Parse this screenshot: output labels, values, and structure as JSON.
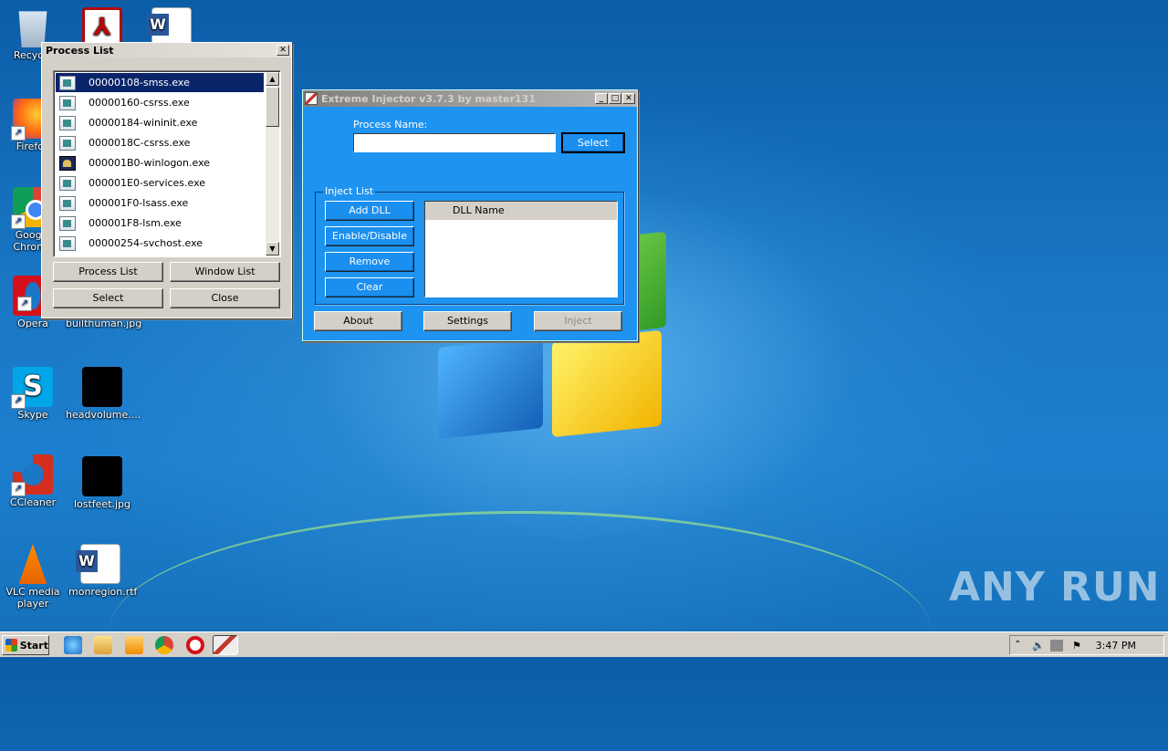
{
  "desktop": {
    "icons": [
      {
        "label": "Recycle",
        "icon": "recycle-bin-icon"
      },
      {
        "label": "",
        "icon": "acrobat-pdf-icon"
      },
      {
        "label": "",
        "icon": "word-document-icon"
      },
      {
        "label": "Firefox",
        "icon": "firefox-icon"
      },
      {
        "label": "Google Chrome",
        "icon": "chrome-icon"
      },
      {
        "label": "Opera",
        "icon": "opera-icon"
      },
      {
        "label": "builthuman.jpg",
        "icon": "image-file-icon"
      },
      {
        "label": "Skype",
        "icon": "skype-icon"
      },
      {
        "label": "headvolume....",
        "icon": "image-file-icon"
      },
      {
        "label": "CCleaner",
        "icon": "ccleaner-icon"
      },
      {
        "label": "lostfeet.jpg",
        "icon": "image-file-icon"
      },
      {
        "label": "VLC media player",
        "icon": "vlc-icon"
      },
      {
        "label": "monregion.rtf",
        "icon": "word-document-icon"
      }
    ]
  },
  "process_list_window": {
    "title": "Process List",
    "close_glyph": "✕",
    "processes": [
      {
        "name": "00000108-smss.exe",
        "selected": true
      },
      {
        "name": "00000160-csrss.exe"
      },
      {
        "name": "00000184-wininit.exe"
      },
      {
        "name": "0000018C-csrss.exe"
      },
      {
        "name": "000001B0-winlogon.exe"
      },
      {
        "name": "000001E0-services.exe"
      },
      {
        "name": "000001F0-lsass.exe"
      },
      {
        "name": "000001F8-lsm.exe"
      },
      {
        "name": "00000254-svchost.exe"
      }
    ],
    "buttons": {
      "process_list": "Process List",
      "window_list": "Window List",
      "select": "Select",
      "close": "Close"
    }
  },
  "injector_window": {
    "title": "Extreme Injector v3.7.3 by master131",
    "process_name_label": "Process Name:",
    "process_name_value": "",
    "select_button": "Select",
    "inject_list_title": "Inject List",
    "buttons": {
      "add_dll": "Add DLL",
      "enable_disable": "Enable/Disable",
      "remove": "Remove",
      "clear": "Clear",
      "about": "About",
      "settings": "Settings",
      "inject": "Inject"
    },
    "dll_column_header": "DLL Name",
    "inject_disabled": true
  },
  "taskbar": {
    "start_label": "Start",
    "quick_launch": [
      "ie-icon",
      "explorer-icon",
      "media-player-icon",
      "chrome-icon",
      "opera-icon",
      "injector-icon"
    ],
    "clock": "3:47 PM"
  },
  "watermark": "ANY RUN",
  "colors": {
    "injector_bg": "#1e93f0",
    "selection": "#0a246a",
    "desktop": "#1a78c6"
  }
}
